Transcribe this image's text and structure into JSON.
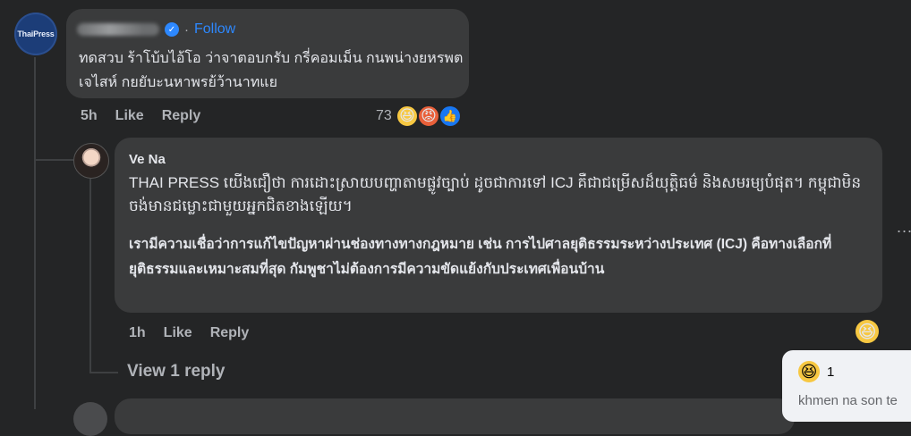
{
  "page_avatar": {
    "label": "ThaiPress"
  },
  "comment1": {
    "follow_label": "Follow",
    "separator": "·",
    "text": "ทดสวบ ร้าโบ้บไอ้โอ ว่าจาตอบกรับ กรี่คอมเม็น กนพน่างยหรพตเจไสห์ กยยับะนหาพรย้ว้านาทแย",
    "time": "5h",
    "like_label": "Like",
    "reply_label": "Reply",
    "reaction_count": "73",
    "reactions": [
      "haha-icon",
      "angry-icon",
      "like-icon"
    ],
    "colors": {
      "follow": "#2d88ff",
      "verified": "#2d88ff"
    }
  },
  "comment2": {
    "author": "Ve Na",
    "text_khmer": "THAI PRESS យើងជឿថា ការដោះស្រាយបញ្ហាតាមផ្លូវច្បាប់ ដូចជាការទៅ ICJ គឺជាជម្រើសដ៏យុត្តិធម៌ និងសមរម្យបំផុត។ កម្ពុជាមិនចង់មានជម្លោះជាមួយអ្នកជិតខាងឡើយ។",
    "text_thai": "เรามีความเชื่อว่าการแก้ไขปัญหาผ่านช่องทางทางกฎหมาย เช่น การไปศาลยุติธรรมระหว่างประเทศ (ICJ) คือทางเลือกที่ยุติธรรมและเหมาะสมที่สุด กัมพูชาไม่ต้องการมีความขัดแย้งกับประเทศเพื่อนบ้าน",
    "time": "1h",
    "like_label": "Like",
    "reply_label": "Reply",
    "reaction": "haha-icon"
  },
  "view_replies_label": "View 1 reply",
  "popup": {
    "reaction": "haha-icon",
    "count": "1",
    "text": "khmen na son te"
  },
  "more_label": "..."
}
